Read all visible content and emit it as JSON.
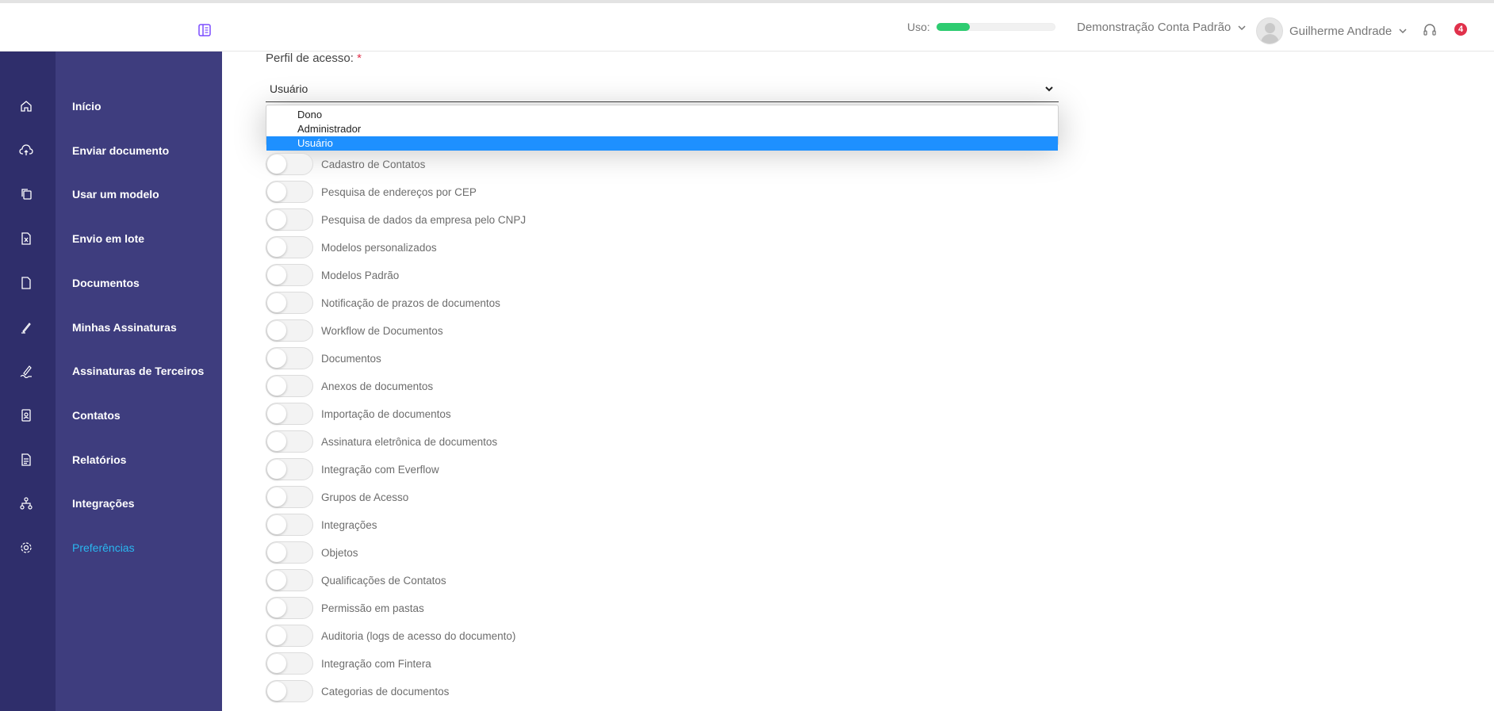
{
  "header": {
    "usage_label": "Uso:",
    "usage_fraction": 0.28,
    "usage_color": "#2ecc71",
    "account_name": "Demonstração Conta Padrão",
    "user_name": "Guilherme Andrade",
    "notification_count": "4"
  },
  "sidebar": {
    "items": [
      {
        "label": "Início",
        "icon": "home-icon"
      },
      {
        "label": "Enviar documento",
        "icon": "cloud-upload-icon"
      },
      {
        "label": "Usar um modelo",
        "icon": "template-icon"
      },
      {
        "label": "Envio em lote",
        "icon": "spreadsheet-icon"
      },
      {
        "label": "Documentos",
        "icon": "document-icon"
      },
      {
        "label": "Minhas Assinaturas",
        "icon": "pen-icon"
      },
      {
        "label": "Assinaturas de Terceiros",
        "icon": "signature-icon"
      },
      {
        "label": "Contatos",
        "icon": "contact-card-icon"
      },
      {
        "label": "Relatórios",
        "icon": "report-icon"
      },
      {
        "label": "Integrações",
        "icon": "integration-icon"
      },
      {
        "label": "Preferências",
        "icon": "gear-icon",
        "active": true
      }
    ]
  },
  "form": {
    "profile_label": "Perfil de acesso:",
    "required_mark": "*",
    "selected_value": "Usuário",
    "options": [
      "Dono",
      "Administrador",
      "Usuário"
    ]
  },
  "permissions": [
    "Cadastro de Contatos",
    "Pesquisa de endereços por CEP",
    "Pesquisa de dados da empresa pelo CNPJ",
    "Modelos personalizados",
    "Modelos Padrão",
    "Notificação de prazos de documentos",
    "Workflow de Documentos",
    "Documentos",
    "Anexos de documentos",
    "Importação de documentos",
    "Assinatura eletrônica de documentos",
    "Integração com Everflow",
    "Grupos de Acesso",
    "Integrações",
    "Objetos",
    "Qualificações de Contatos",
    "Permissão em pastas",
    "Auditoria (logs de acesso do documento)",
    "Integração com Fintera",
    "Categorias de documentos"
  ]
}
